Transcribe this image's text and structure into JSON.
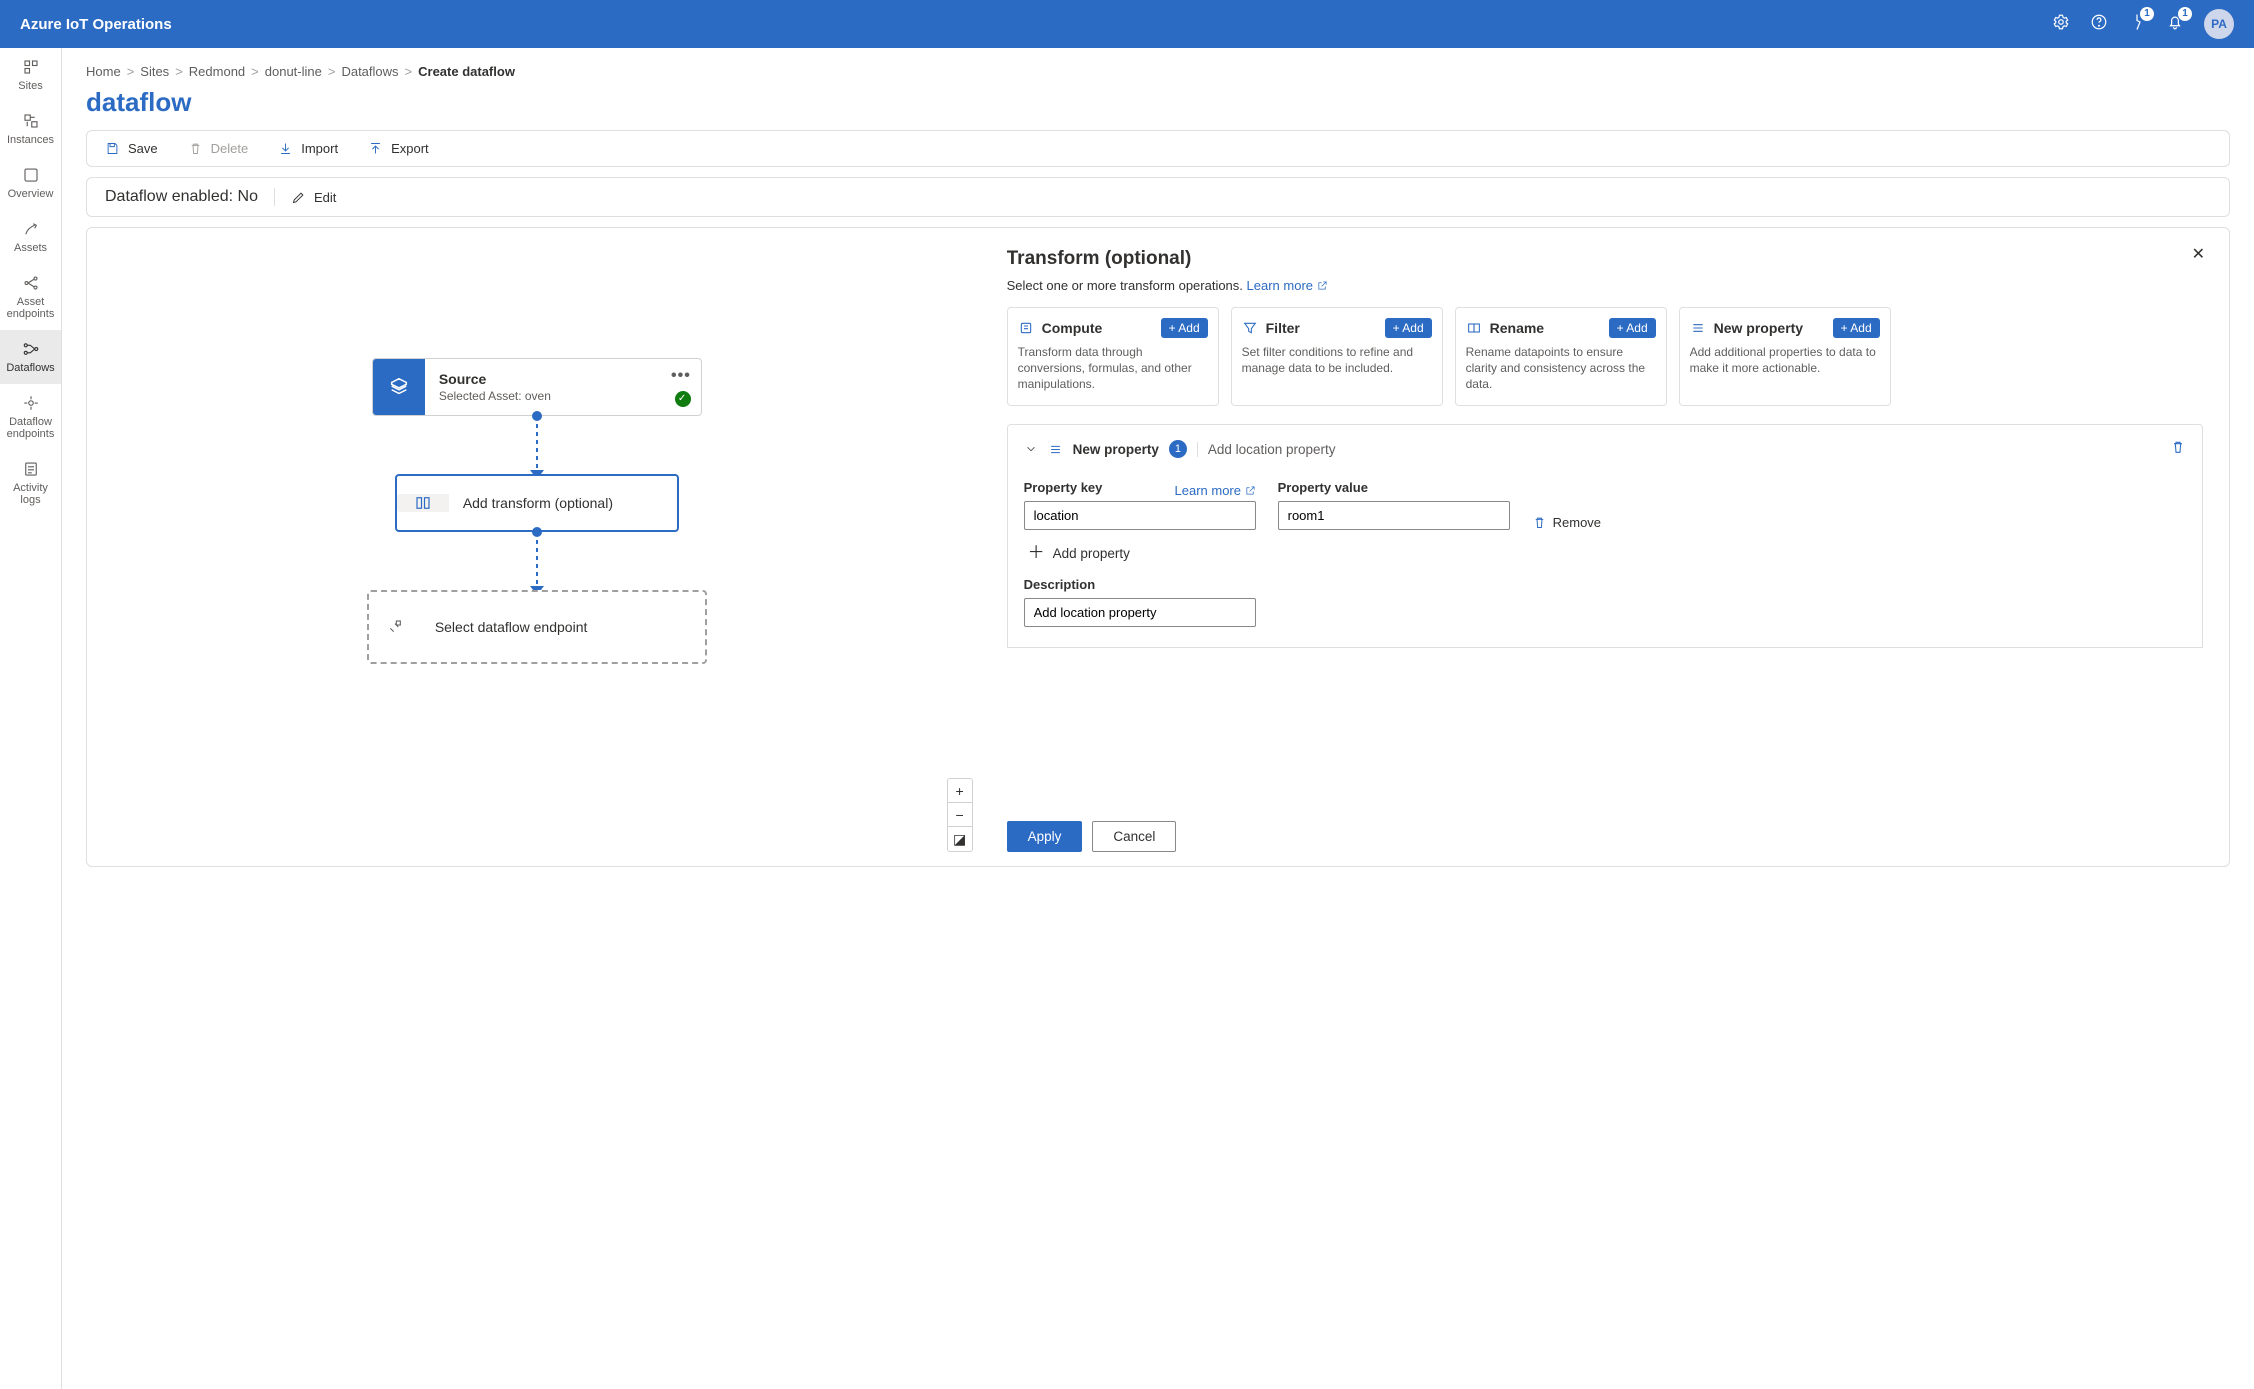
{
  "app": {
    "title": "Azure IoT Operations",
    "avatar": "PA",
    "badge1": "1",
    "badge2": "1"
  },
  "nav": {
    "sites": "Sites",
    "instances": "Instances",
    "overview": "Overview",
    "assets": "Assets",
    "asset_endpoints": "Asset endpoints",
    "dataflows": "Dataflows",
    "dataflow_endpoints": "Dataflow endpoints",
    "activity_logs": "Activity logs"
  },
  "breadcrumb": {
    "items": [
      "Home",
      "Sites",
      "Redmond",
      "donut-line",
      "Dataflows"
    ],
    "current": "Create dataflow"
  },
  "page": {
    "title": "dataflow"
  },
  "cmdbar": {
    "save": "Save",
    "delete": "Delete",
    "import": "Import",
    "export": "Export"
  },
  "status": {
    "label": "Dataflow enabled:",
    "value": "No",
    "edit": "Edit"
  },
  "canvas": {
    "source": {
      "title": "Source",
      "subtitle": "Selected Asset: oven",
      "more": "•••"
    },
    "transform": {
      "title": "Add transform (optional)"
    },
    "endpoint": {
      "title": "Select dataflow endpoint"
    },
    "zoom": {
      "in": "+",
      "out": "−",
      "fit": "◪"
    }
  },
  "panel": {
    "title": "Transform (optional)",
    "sub": "Select one or more transform operations.",
    "learn_more": "Learn more",
    "add": "+ Add",
    "cards": {
      "compute": {
        "title": "Compute",
        "desc": "Transform data through conversions, formulas, and other manipulations."
      },
      "filter": {
        "title": "Filter",
        "desc": "Set filter conditions to refine and manage data to be included."
      },
      "rename": {
        "title": "Rename",
        "desc": "Rename datapoints to ensure clarity and consistency across the data."
      },
      "newprop": {
        "title": "New property",
        "desc": "Add additional properties to data to make it more actionable."
      }
    },
    "prop": {
      "heading": "New property",
      "count": "1",
      "subtitle": "Add location property",
      "key_label": "Property key",
      "key_value": "location",
      "val_label": "Property value",
      "val_value": "room1",
      "remove": "Remove",
      "add_property": "Add property",
      "desc_label": "Description",
      "desc_value": "Add location property",
      "learn_more": "Learn more"
    },
    "apply": "Apply",
    "cancel": "Cancel"
  }
}
